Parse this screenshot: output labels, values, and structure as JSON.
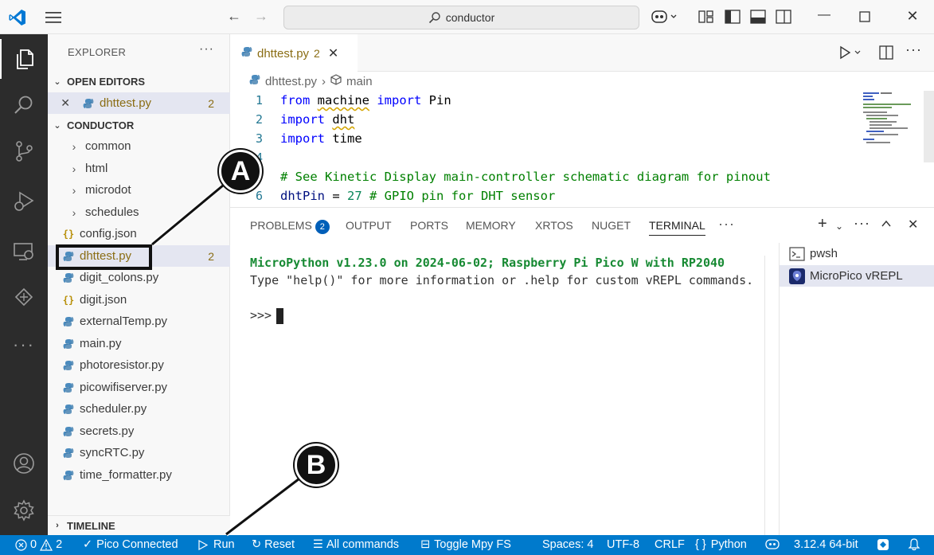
{
  "titlebar": {
    "search_text": "conductor",
    "window_controls": [
      "minimize",
      "maximize",
      "close"
    ]
  },
  "activity_bar": {
    "items": [
      "explorer-icon",
      "search-icon",
      "source-control-icon",
      "run-debug-icon",
      "remote-explorer-icon",
      "pico-icon",
      "more-icon",
      "account-icon",
      "settings-icon"
    ]
  },
  "sidebar": {
    "title": "EXPLORER",
    "more": "···",
    "open_editors": {
      "label": "OPEN EDITORS",
      "items": [
        {
          "name": "dhttest.py",
          "count": "2"
        }
      ]
    },
    "workspace": {
      "label": "CONDUCTOR",
      "folders": [
        "common",
        "html",
        "microdot",
        "schedules"
      ],
      "files": [
        {
          "name": "config.json",
          "type": "json"
        },
        {
          "name": "dhttest.py",
          "type": "py",
          "count": "2"
        },
        {
          "name": "digit_colons.py",
          "type": "py"
        },
        {
          "name": "digit.json",
          "type": "json"
        },
        {
          "name": "externalTemp.py",
          "type": "py"
        },
        {
          "name": "main.py",
          "type": "py"
        },
        {
          "name": "photoresistor.py",
          "type": "py"
        },
        {
          "name": "picowifiserver.py",
          "type": "py"
        },
        {
          "name": "scheduler.py",
          "type": "py"
        },
        {
          "name": "secrets.py",
          "type": "py"
        },
        {
          "name": "syncRTC.py",
          "type": "py"
        },
        {
          "name": "time_formatter.py",
          "type": "py"
        }
      ]
    },
    "timeline_label": "TIMELINE"
  },
  "editor": {
    "tab": {
      "name": "dhttest.py",
      "count": "2"
    },
    "breadcrumb": [
      "dhttest.py",
      "main"
    ],
    "code_lines": [
      {
        "n": "1",
        "text": "from machine import Pin"
      },
      {
        "n": "2",
        "text": "import dht"
      },
      {
        "n": "3",
        "text": "import time"
      },
      {
        "n": "4",
        "text": ""
      },
      {
        "n": "5",
        "text": "# See Kinetic Display main-controller schematic diagram for pinout"
      },
      {
        "n": "6",
        "text": "dhtPin = 27 # GPIO pin for DHT sensor"
      }
    ]
  },
  "panel": {
    "tabs": [
      "PROBLEMS",
      "OUTPUT",
      "PORTS",
      "MEMORY",
      "XRTOS",
      "NUGET",
      "TERMINAL"
    ],
    "problems_count": "2",
    "active_tab": "TERMINAL",
    "more": "···",
    "terminal": {
      "line1": "MicroPython v1.23.0 on 2024-06-02; Raspberry Pi Pico W with RP2040",
      "line2": "Type \"help()\" for more information or .help for custom vREPL commands.",
      "prompt": ">>>"
    },
    "terminals": [
      {
        "name": "pwsh"
      },
      {
        "name": "MicroPico vREPL"
      }
    ]
  },
  "statusbar": {
    "errors": "0",
    "warnings": "2",
    "pico_connected": "Pico Connected",
    "run": "Run",
    "reset": "Reset",
    "all_commands": "All commands",
    "toggle_fs": "Toggle Mpy FS",
    "spaces": "Spaces: 4",
    "encoding": "UTF-8",
    "eol": "CRLF",
    "language": "Python",
    "python_version": "3.12.4 64-bit"
  },
  "callouts": {
    "a": "A",
    "b": "B"
  },
  "colors": {
    "accent": "#007acc",
    "activity_bg": "#2c2c2c",
    "warning_text": "#8a6d14",
    "terminal_green": "#178a33"
  }
}
